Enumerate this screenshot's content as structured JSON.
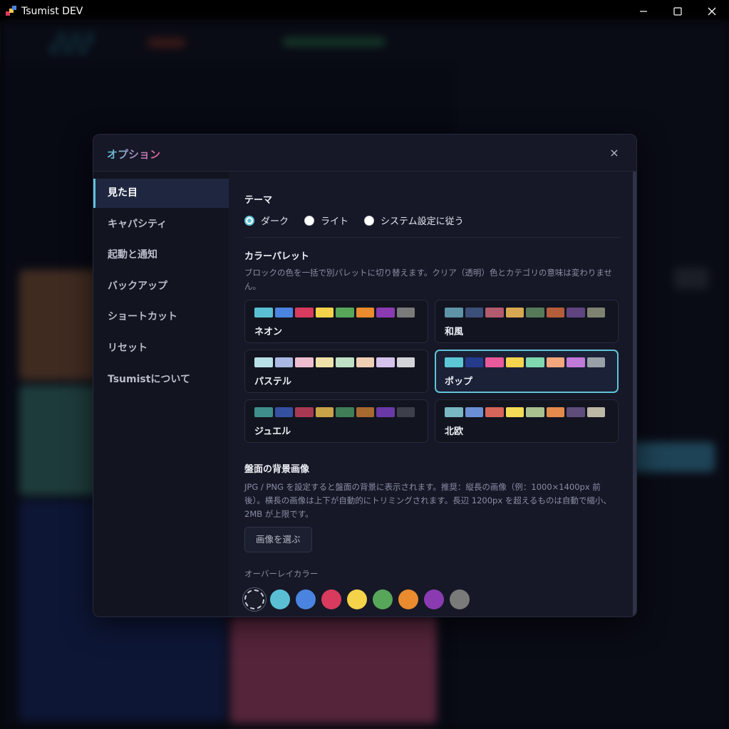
{
  "window": {
    "title": "Tsumist DEV"
  },
  "dialog": {
    "title": "オプション",
    "close_label": "×"
  },
  "sidebar": {
    "items": [
      {
        "label": "見た目",
        "active": true
      },
      {
        "label": "キャパシティ"
      },
      {
        "label": "起動と通知"
      },
      {
        "label": "バックアップ"
      },
      {
        "label": "ショートカット"
      },
      {
        "label": "リセット"
      },
      {
        "label": "Tsumistについて"
      }
    ]
  },
  "theme": {
    "title": "テーマ",
    "options": [
      {
        "label": "ダーク",
        "selected": true
      },
      {
        "label": "ライト"
      },
      {
        "label": "システム設定に従う"
      }
    ]
  },
  "palette": {
    "title": "カラーパレット",
    "description": "ブロックの色を一括で別パレットに切り替えます。クリア（透明）色とカテゴリの意味は変わりません。",
    "items": [
      {
        "name": "ネオン",
        "colors": [
          "#5bbfd4",
          "#4a84e0",
          "#d83b5d",
          "#f4d24a",
          "#57a65a",
          "#e98b2e",
          "#8a3bb1",
          "#7a7a7a"
        ]
      },
      {
        "name": "和風",
        "colors": [
          "#5e93a8",
          "#3b4f78",
          "#b25a6e",
          "#d6a851",
          "#567a59",
          "#b45d3a",
          "#5e4580",
          "#7f8270"
        ]
      },
      {
        "name": "パステル",
        "colors": [
          "#b8e0e6",
          "#a9b9e3",
          "#eebed0",
          "#efe2a8",
          "#bfe0c5",
          "#efcfb4",
          "#d5c3ec",
          "#d2d4da"
        ]
      },
      {
        "name": "ポップ",
        "colors": [
          "#5cc8d6",
          "#253c8c",
          "#e85a9b",
          "#f5d44e",
          "#7fd8b0",
          "#f2a77c",
          "#c07ad8",
          "#9aa0a8"
        ],
        "selected": true
      },
      {
        "name": "ジュエル",
        "colors": [
          "#3f8f8c",
          "#3450a0",
          "#a63a52",
          "#c9a348",
          "#3f7e57",
          "#a6692f",
          "#6a39a6",
          "#3d3f4a"
        ]
      },
      {
        "name": "北欧",
        "colors": [
          "#79b7c2",
          "#6b8fd4",
          "#d6655a",
          "#f5dc57",
          "#a9c08f",
          "#e38b4c",
          "#5e4c7a",
          "#bdb7a6"
        ]
      }
    ]
  },
  "background_image": {
    "title": "盤面の背景画像",
    "description": "JPG / PNG を設定すると盤面の背景に表示されます。推奨：縦長の画像（例：1000×1400px 前後）。横長の画像は上下が自動的にトリミングされます。長辺 1200px を超えるものは自動で縮小、2MB が上限です。",
    "button_label": "画像を選ぶ",
    "overlay_label": "オーバーレイカラー",
    "overlay_colors": [
      "none",
      "#5bbfd4",
      "#4a84e0",
      "#d83b5d",
      "#f4d24a",
      "#57a65a",
      "#e98b2e",
      "#8a3bb1",
      "#7a7a7a"
    ]
  }
}
